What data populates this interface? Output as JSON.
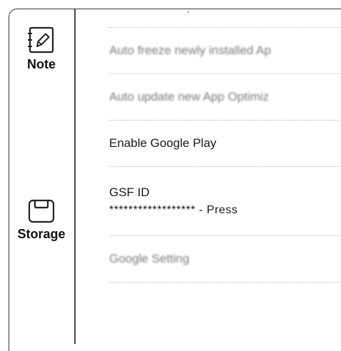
{
  "nav": {
    "note_label": "Note",
    "storage_label": "Storage"
  },
  "settings": {
    "items": [
      {
        "label": "Auto freeze newly installed Ap"
      },
      {
        "label": "Auto update new App Optimiz"
      },
      {
        "label": "Enable Google Play"
      },
      {
        "label": "GSF ID",
        "value": "****************** - Press"
      },
      {
        "label": "Google Setting"
      }
    ]
  },
  "icons": {
    "note": "notebook-pen-icon",
    "storage": "storage-icon"
  },
  "colors": {
    "divider": "#4a4a4a",
    "dotted_separator": "#bdbdbd",
    "disabled_text": "#7a7a7a"
  }
}
